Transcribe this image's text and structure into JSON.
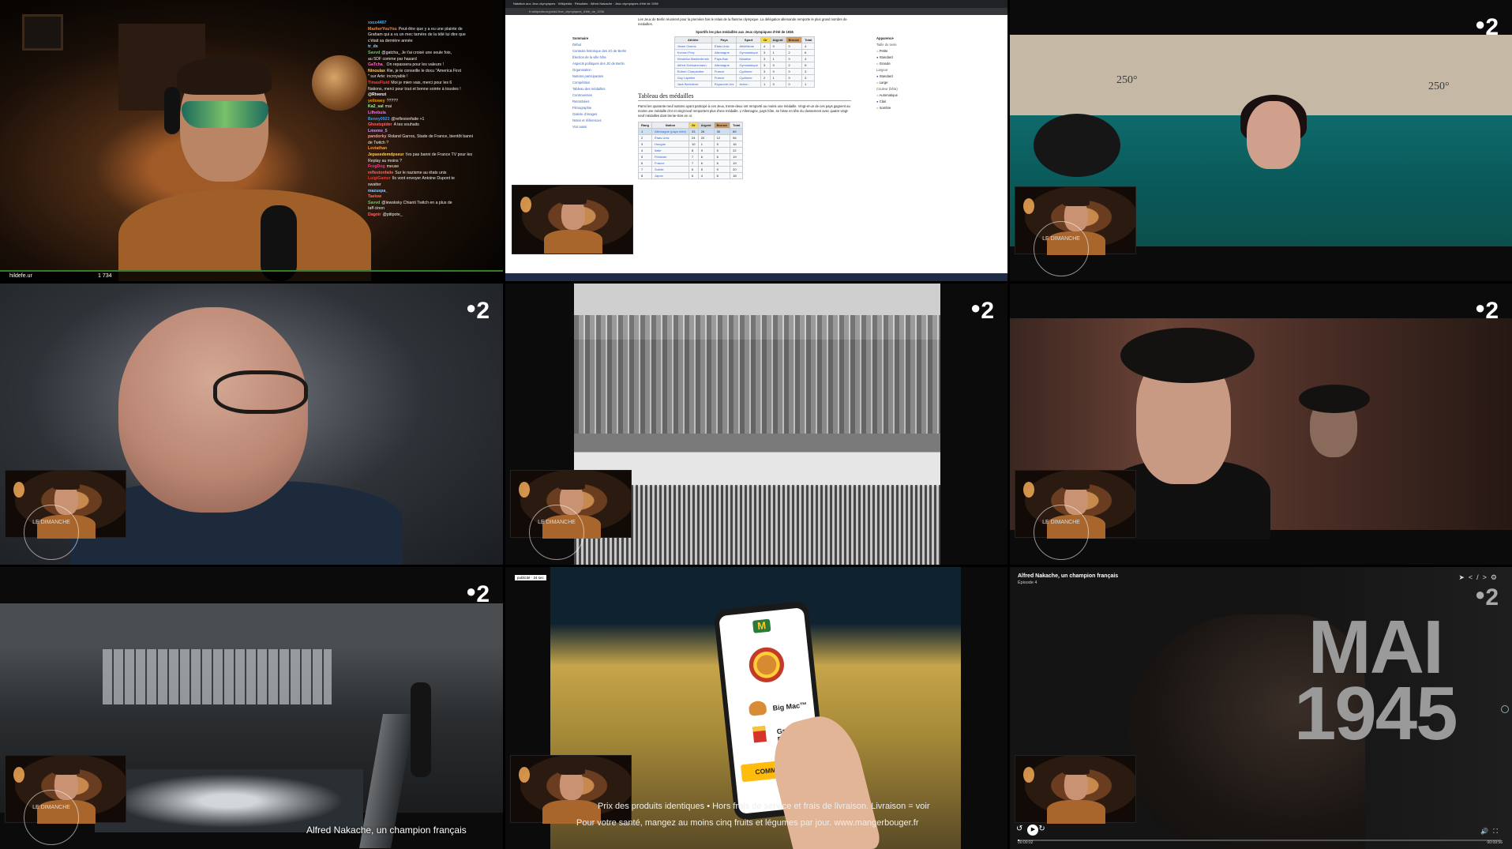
{
  "channel_logo": "2",
  "tile1": {
    "streamer_name": "hildefe.ur",
    "viewer_count": "1 734",
    "chat": [
      {
        "user": "xxco4407",
        "text": "",
        "color": "#4fb3ff"
      },
      {
        "user": "MazherYouYou",
        "text": "Peut-être que y a eu une plainte de",
        "color": "#ff8a3a"
      },
      {
        "user": "",
        "text": "Graham qui a vu un mec tamère de la télé lui dire que",
        "color": "#fff"
      },
      {
        "user": "",
        "text": "c'était sa dernière année",
        "color": "#fff"
      },
      {
        "user": "tr_ds",
        "text": "",
        "color": "#9cf"
      },
      {
        "user": "Savvd",
        "text": "@gatcha_ Je t'ai croisé une seule fois,",
        "color": "#6c6"
      },
      {
        "user": "",
        "text": "au 5DF comme par hasard",
        "color": "#fff"
      },
      {
        "user": "GaTcha_",
        "text": "On repassera pour les valeurs !",
        "color": "#f6c"
      },
      {
        "user": "Ninoulax",
        "text": "Rie, je te conseille le docu \"America First",
        "color": "#fc6"
      },
      {
        "user": "",
        "text": "\" sur Arte: incroyable !",
        "color": "#fff"
      },
      {
        "user": "TimasFluid",
        "text": "Moi je mien vais, merci pour les 6",
        "color": "#f44"
      },
      {
        "user": "",
        "text": "Nations, merci pour tout et bonne soirée à toustes !",
        "color": "#fff"
      },
      {
        "user": "@Rivenzi",
        "text": "",
        "color": "#fff"
      },
      {
        "user": "yellowey",
        "text": "?????",
        "color": "#f90"
      },
      {
        "user": "Ka2_sal",
        "text": "mai",
        "color": "#9f9"
      },
      {
        "user": "Lilhebula",
        "text": "",
        "color": "#f6f"
      },
      {
        "user": "Benny0923",
        "text": "@reflexionfaite +1",
        "color": "#39f"
      },
      {
        "user": "Ghostspider",
        "text": "A tes souhaits",
        "color": "#f66"
      },
      {
        "user": "Lmomo_5",
        "text": "",
        "color": "#c9f"
      },
      {
        "user": "pandorky",
        "text": "Roland Garros, Stade de France, bientôt banni",
        "color": "#f99"
      },
      {
        "user": "",
        "text": "de Twitch ?",
        "color": "#fff"
      },
      {
        "user": "Leviathan",
        "text": "",
        "color": "#f93"
      },
      {
        "user": "Jepasedemdpseur",
        "text": "t'es pas banni de France TV pour les",
        "color": "#fc6"
      },
      {
        "user": "",
        "text": "Replay au moins ?",
        "color": "#fff"
      },
      {
        "user": "FrogDog",
        "text": "meuse",
        "color": "#f39"
      },
      {
        "user": "reflexionfaite",
        "text": "Sur le nazisme au états unis",
        "color": "#f66"
      },
      {
        "user": "LuigiGamer",
        "text": "Ils vont envoyer Antoine Dupont te",
        "color": "#f33"
      },
      {
        "user": "",
        "text": "swatter",
        "color": "#fff"
      },
      {
        "user": "mazuspa_",
        "text": "",
        "color": "#9cf"
      },
      {
        "user": "Taelow",
        "text": "",
        "color": "#f66"
      },
      {
        "user": "Savvd",
        "text": "@lewsksky Chianti Twitch en a plus de",
        "color": "#6c6"
      },
      {
        "user": "",
        "text": "taff cinon",
        "color": "#fff"
      },
      {
        "user": "Dagnir",
        "text": "@ptitpote_",
        "color": "#f66"
      }
    ]
  },
  "tile2": {
    "tabs_text": "Natation aux Jeux olympiques · Wikipédia  ·  Résultats  ·  Alfred Nakache  ·  Jeux olympiques d'été de 1936",
    "url": "fr.wikipedia.org/wiki/Jeux_olympiques_d'été_de_1936",
    "toc_title": "Sommaire",
    "toc_items": [
      "Début",
      "Contexte historique des JO de Berlin",
      "Élection de la ville hôte",
      "Aspects politiques des JO de Berlin",
      "Organisation",
      "Nations participantes",
      "Compétition",
      "Tableau des médailles",
      "Controverses",
      "Retombées",
      "Filmographie",
      "Galerie d'images",
      "Notes et références",
      "Voir aussi"
    ],
    "intro": "Les Jeux de Berlin réunirent pour la première fois le relais de la flamme olympique. La délégation allemande remporte le plus grand nombre de médailles.",
    "table_title": "Sportifs les plus médaillés aux Jeux olympiques d'été de 1936",
    "top_athletes_headers": [
      "Athlète",
      "Pays",
      "Sport",
      "Or",
      "Argent",
      "Bronze",
      "Total"
    ],
    "top_athletes": [
      [
        "Jesse Owens",
        "États-Unis",
        "Athlétisme",
        "4",
        "0",
        "0",
        "4"
      ],
      [
        "Konrad Frey",
        "Allemagne",
        "Gymnastique",
        "3",
        "1",
        "2",
        "6"
      ],
      [
        "Hendrika Mastenbroek",
        "Pays-Bas",
        "Natation",
        "3",
        "1",
        "0",
        "4"
      ],
      [
        "Alfred Schwarzmann",
        "Allemagne",
        "Gymnastique",
        "3",
        "0",
        "2",
        "5"
      ],
      [
        "Robert Charpentier",
        "France",
        "Cyclisme",
        "3",
        "0",
        "0",
        "3"
      ],
      [
        "Guy Lapébie",
        "France",
        "Cyclisme",
        "2",
        "1",
        "0",
        "3"
      ],
      [
        "Jack Beresford",
        "Royaume-Uni",
        "Aviron",
        "1",
        "0",
        "0",
        "1"
      ]
    ],
    "medal_heading": "Tableau des médailles",
    "medal_intro": "Parmi les quarante-neuf nations ayant participé à ces Jeux, trente-deux ont remporté au moins une médaille. Vingt-et-un de ces pays gagnent au moins une médaille d'or et vingt-neuf remportent plus d'une médaille. L'Allemagne, pays hôte, se hisse en tête du classement avec quatre-vingt-neuf médailles dont trente-trois en or.",
    "medal_headers": [
      "Rang",
      "Nation",
      "Or",
      "Argent",
      "Bronze",
      "Total"
    ],
    "medals": [
      [
        "1",
        "Allemagne (pays hôte)",
        "33",
        "26",
        "30",
        "89"
      ],
      [
        "2",
        "États-Unis",
        "24",
        "20",
        "12",
        "56"
      ],
      [
        "3",
        "Hongrie",
        "10",
        "1",
        "5",
        "16"
      ],
      [
        "4",
        "Italie",
        "8",
        "9",
        "5",
        "22"
      ],
      [
        "5",
        "Finlande",
        "7",
        "6",
        "6",
        "19"
      ],
      [
        "6",
        "France",
        "7",
        "6",
        "6",
        "19"
      ],
      [
        "7",
        "Suède",
        "6",
        "5",
        "9",
        "20"
      ],
      [
        "8",
        "Japon",
        "6",
        "4",
        "8",
        "18"
      ]
    ],
    "appearance_title": "Apparence",
    "appearance": [
      {
        "label": "Taille du texte",
        "head": true
      },
      {
        "label": "Petite",
        "on": false
      },
      {
        "label": "Standard",
        "on": true
      },
      {
        "label": "Grande",
        "on": false
      },
      {
        "label": "Largeur",
        "head": true
      },
      {
        "label": "Standard",
        "on": true
      },
      {
        "label": "Large",
        "on": false
      },
      {
        "label": "Couleur (bêta)",
        "head": true
      },
      {
        "label": "Automatique",
        "on": false
      },
      {
        "label": "Clair",
        "on": true
      },
      {
        "label": "Sombre",
        "on": false
      }
    ]
  },
  "tile3": {
    "mark1": "250°",
    "mark2": "250°",
    "badge": "LE DIMANCHE"
  },
  "tile4": {
    "badge": "LE DIMANCHE"
  },
  "tile5": {
    "badge": "LE DIMANCHE"
  },
  "tile6": {
    "badge": "LE DIMANCHE"
  },
  "tile7": {
    "badge": "LE DIMANCHE",
    "subtitle": "Alfred Nakache, un champion français"
  },
  "tile8": {
    "pub_label": "publicité · 34 sec",
    "item1": "Big Mac™",
    "item2": "Grande Frite",
    "order_button": "COMMANDER",
    "legal1": "Prix des produits identiques • Hors frais de service et frais de livraison. Livraison = voir",
    "legal2": "Pour votre santé, mangez au moins cinq fruits et légumes par jour. www.mangerbouger.fr"
  },
  "tile9": {
    "title": "Alfred Nakache, un champion français",
    "episode": "Épisode 4",
    "big_line1": "MAI",
    "big_line2": "1945",
    "time_current": "00:00:02",
    "time_total": "00:09:56",
    "progress_fraction": 0.004
  }
}
